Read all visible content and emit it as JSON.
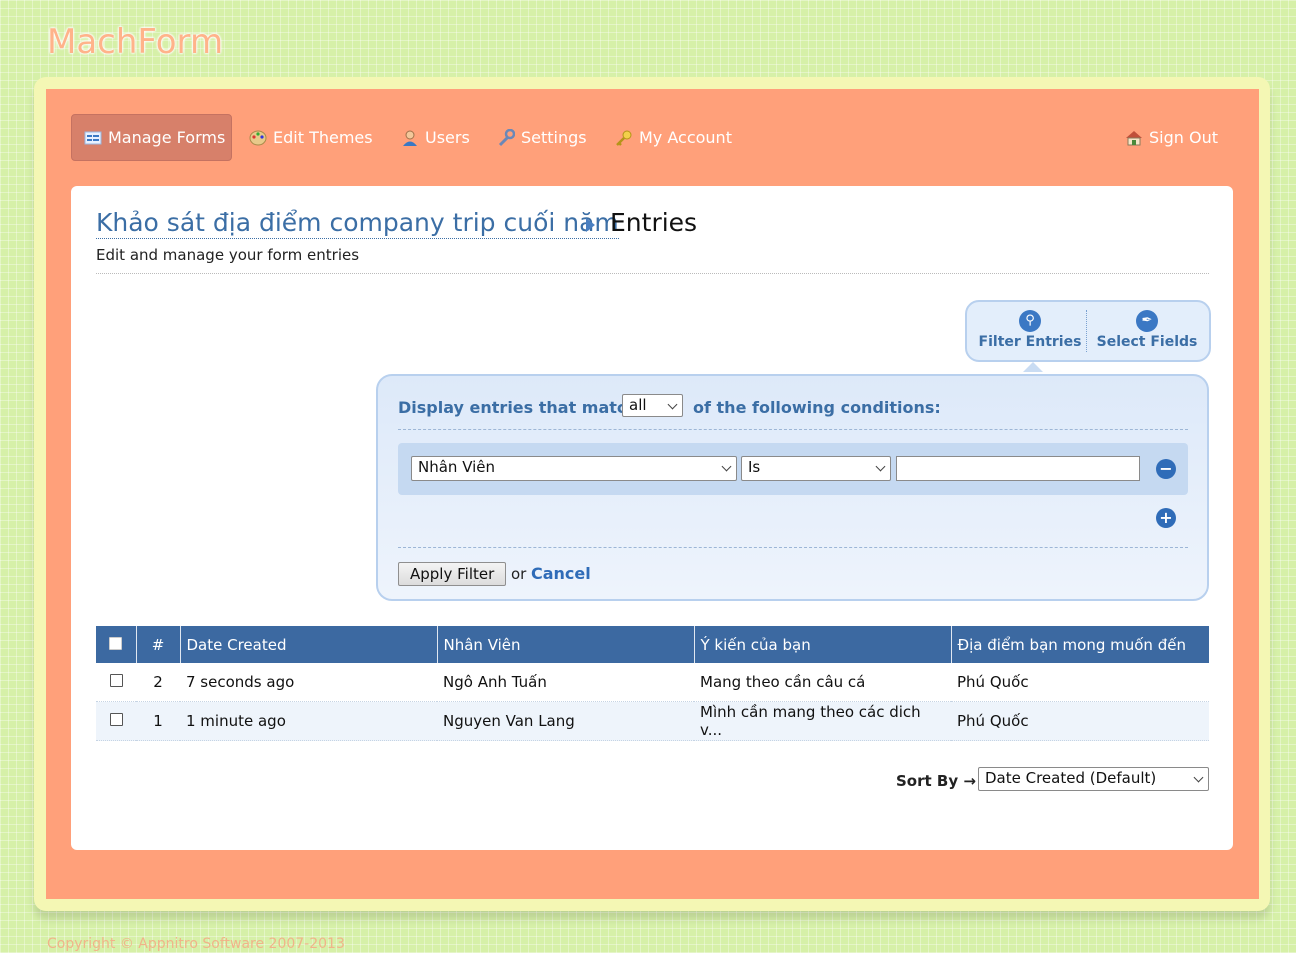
{
  "brand": {
    "logo_text": "MachForm"
  },
  "nav": {
    "manage_forms": "Manage Forms",
    "edit_themes": "Edit Themes",
    "users": "Users",
    "settings": "Settings",
    "my_account": "My Account",
    "sign_out": "Sign Out"
  },
  "breadcrumb": {
    "form_name": "Khảo sát địa điểm company trip cuối năm",
    "current": "Entries"
  },
  "subtitle": "Edit and manage your form entries",
  "tabs": {
    "filter_entries": "Filter Entries",
    "select_fields": "Select Fields"
  },
  "filter": {
    "title_prefix": "Display entries that match",
    "match_value": "all",
    "title_suffix": "of the following conditions:",
    "condition": {
      "field": "Nhân Viên",
      "operator": "Is",
      "value": ""
    },
    "apply_label": "Apply Filter",
    "or_text": "or",
    "cancel_label": "Cancel"
  },
  "table": {
    "columns": [
      "#",
      "Date Created",
      "Nhân Viên",
      "Ý kiến của bạn",
      "Địa điểm bạn mong muốn đến"
    ],
    "rows": [
      {
        "id": "2",
        "date": "7 seconds ago",
        "employee": "Ngô Anh Tuấn",
        "opinion": "Mang theo cần câu cá",
        "place": "Phú Quốc"
      },
      {
        "id": "1",
        "date": "1 minute ago",
        "employee": "Nguyen Van Lang",
        "opinion": "Mình cần mang theo các dich v...",
        "place": "Phú Quốc"
      }
    ]
  },
  "sort": {
    "label": "Sort By →",
    "value": "Date Created (Default)"
  },
  "footer": "Copyright © Appnitro Software 2007-2013",
  "colors": {
    "background": "#d6f0a8",
    "panel": "#ffa07a",
    "header_row": "#3c69a1",
    "link": "#3b6ea5"
  }
}
